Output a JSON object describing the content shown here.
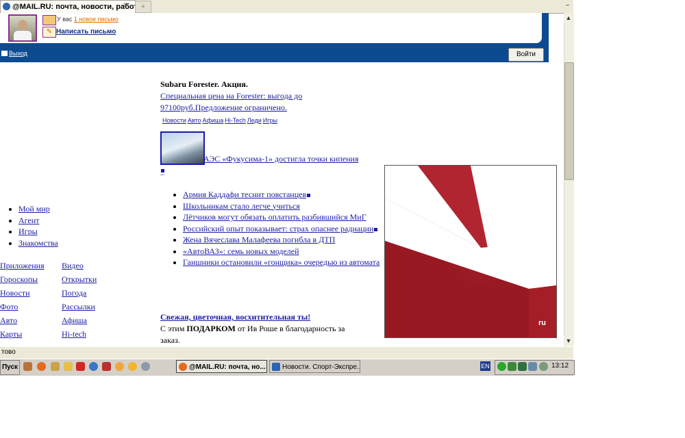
{
  "browser": {
    "tab_title": "@MAIL.RU: почта, новости, работа, ...",
    "tab_close": "×",
    "new_tab": "+",
    "tab_menu": "−",
    "status_text": "тово"
  },
  "mail_panel": {
    "mail_prefix": "У вас",
    "new_mail_link": "1 новое письмо",
    "write_link": "Написать письмо",
    "logout_label": "Выход",
    "login_button": "Войти"
  },
  "promo": {
    "title": "Subaru Forester. Акция.",
    "text": "Специальная цена на Forester: выгода до 97100руб.Предложение ограничено.",
    "mini_nav": [
      "Новости",
      "Авто",
      "Афиша",
      "Hi-Tech",
      "Леди",
      "Игры"
    ]
  },
  "headline": "АЭС «Фукусима-1» достигла точки кипения",
  "news": [
    "Армия Каддафи теснит повстанцев",
    "Школьникам стало легче учиться",
    "Лётчиков могут обязать оплатить разбившийся МиГ",
    "Российский опыт показывает: страх опаснее радиации",
    "Жена Вячеслава Малафеева погибла в ДТП",
    "«АвтоВАЗ»: семь новых моделей",
    "Гаишники остановили «гонщика» очередью из автомата"
  ],
  "fresh": {
    "title": "Свежая, цветочная, восхитительная ты!",
    "text_before": "С этим ",
    "text_bold": "ПОДАРКОМ",
    "text_after": " от Ив Роше в благодарность за заказ."
  },
  "mir_list": [
    "Мой мир",
    "Агент",
    "Игры",
    "Знакомства"
  ],
  "services": [
    [
      "Приложения",
      "Видео"
    ],
    [
      "Гороскопы",
      "Открытки"
    ],
    [
      "Новости",
      "Погода"
    ],
    [
      "Фото",
      "Рассылки"
    ],
    [
      "Авто",
      "Афиша"
    ],
    [
      "Карты",
      "Hi-tech"
    ]
  ],
  "ad": {
    "logo_suffix": "ru",
    "bg_color": "#a41d27"
  },
  "taskbar": {
    "start": "Пуск",
    "tasks": [
      "@MAIL.RU: почта, но...",
      "Новости. Спорт-Экспре..."
    ],
    "lang": "EN",
    "clock": "13:12"
  }
}
